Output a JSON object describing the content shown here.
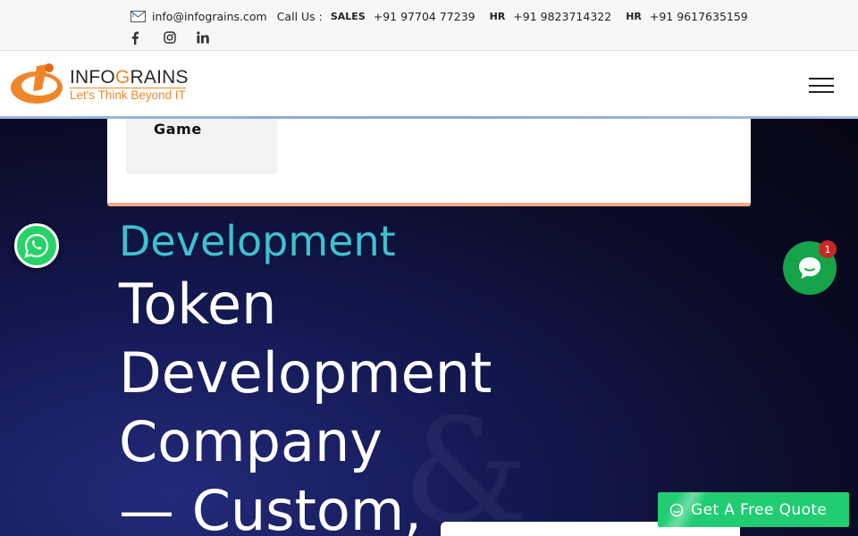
{
  "topbar": {
    "email": "info@infograins.com",
    "call_label": "Call Us :",
    "contacts": [
      {
        "tag": "SALES",
        "number": "+91 97704 77239"
      },
      {
        "tag": "HR",
        "number": "+91 9823714322"
      },
      {
        "tag": "HR",
        "number": "+91 9617635159"
      }
    ],
    "social_icons": [
      "facebook-icon",
      "instagram-icon",
      "linkedin-icon"
    ]
  },
  "logo": {
    "brand_pre": "INFO",
    "brand_g": "G",
    "brand_post": "RAINS",
    "tagline": "Let's Think Beyond IT"
  },
  "dropdown": {
    "tile_label": "Game"
  },
  "hero": {
    "subtitle": "Development",
    "title_lines": [
      "Token",
      "Development",
      "Company",
      "— Custom,"
    ]
  },
  "chat": {
    "badge_count": "1"
  },
  "cta": {
    "quote_label": "Get A Free Quote"
  },
  "colors": {
    "accent_orange": "#f0862a",
    "subtitle_teal": "#3ec1cf",
    "whatsapp_green": "#25d366",
    "quote_green": "#21cc73",
    "badge_red": "#c62828"
  }
}
